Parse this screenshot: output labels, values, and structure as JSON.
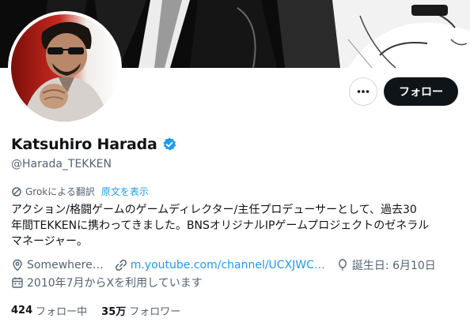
{
  "profile": {
    "display_name": "Katsuhiro Harada",
    "handle": "@Harada_TEKKEN",
    "verified_icon": "verified-badge-icon",
    "verified_color": "#1d9bf0"
  },
  "actions": {
    "more_icon": "more-icon",
    "follow_label": "フォロー"
  },
  "translate": {
    "label": "Grokによる翻訳",
    "link": "原文を表示"
  },
  "bio": {
    "line1": "アクション/格闘ゲームのゲームディレクター/主任プロデューサーとして、過去30",
    "line2": "年間TEKKENに携わってきました。BNSオリジナルIPゲームプロジェクトのゼネラル",
    "line3": "マネージャー。"
  },
  "meta": {
    "location": "Somewhere…",
    "link": "m.youtube.com/channel/UCXJWC…",
    "birthday": "誕生日: 6月10日",
    "joined": "2010年7月からXを利用しています"
  },
  "counts": {
    "following_count": "424",
    "following_label": "フォロー中",
    "followers_count": "35万",
    "followers_label": "フォロワー"
  },
  "colors": {
    "accent": "#1d9bf0",
    "text": "#0f1419",
    "muted": "#536471",
    "follow_bg": "#0f1419"
  }
}
